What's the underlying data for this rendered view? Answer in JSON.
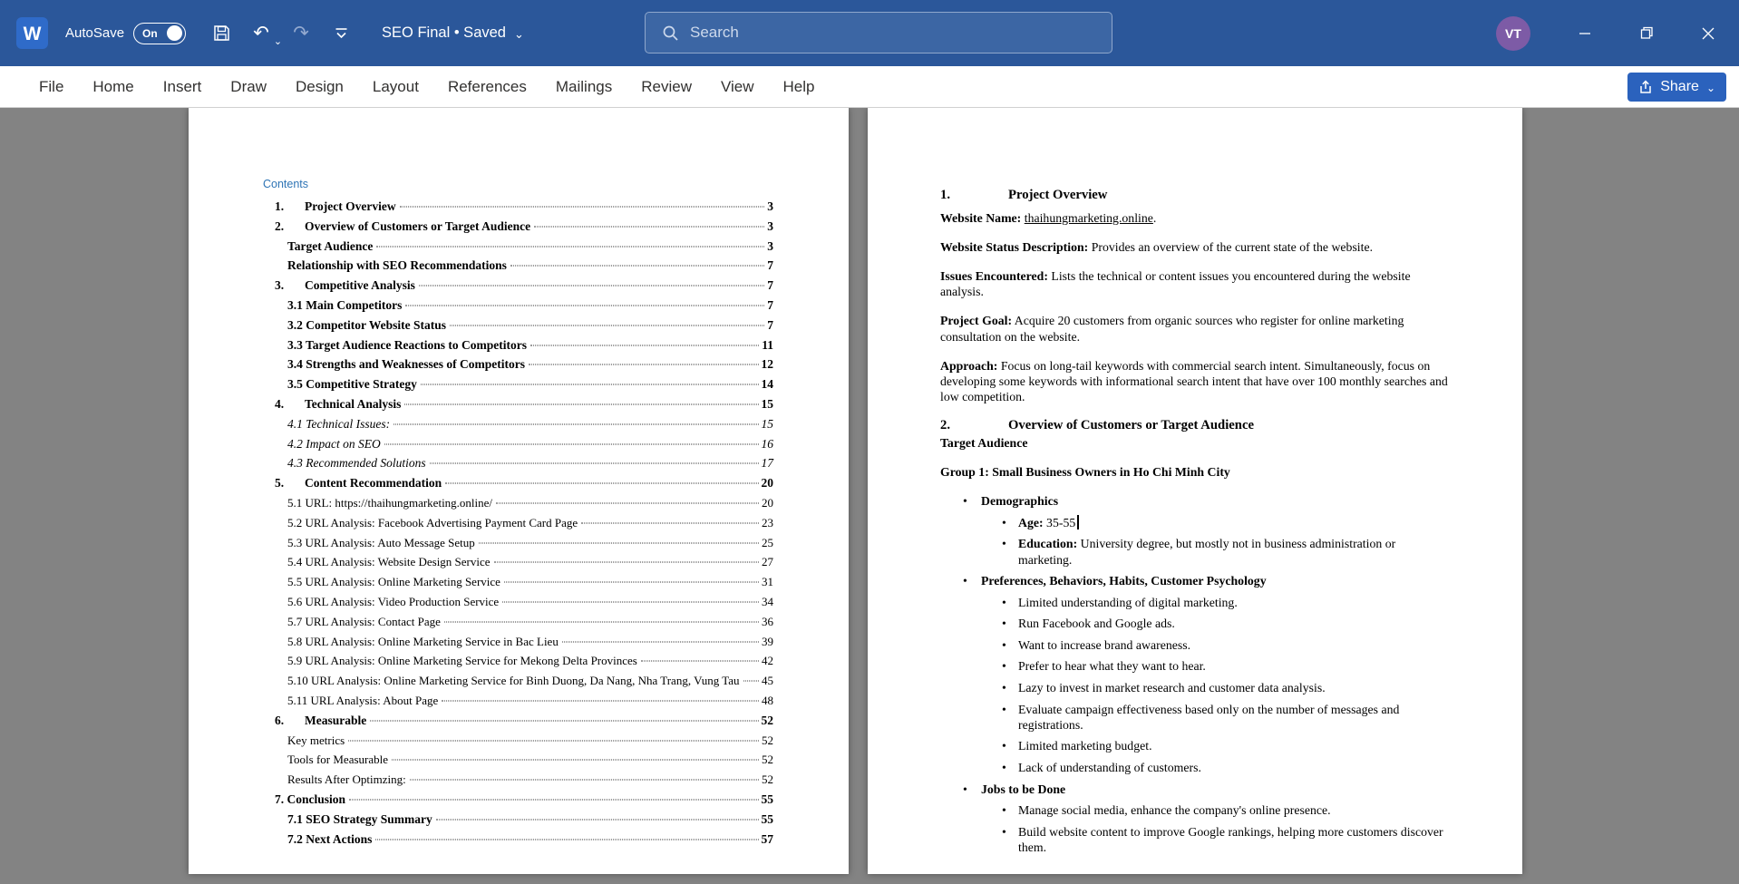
{
  "colors": {
    "titlebar": "#2b579a",
    "search_bg": "#3c66a4",
    "search_border": "#8fa7cc",
    "avatar_bg": "#7d5ba6",
    "toc_heading": "#2e74b5",
    "share_button": "#2b62bd",
    "doc_bg": "#838383"
  },
  "titlebar": {
    "autosave_label": "AutoSave",
    "autosave_state": "On",
    "doc_title": "SEO Final • Saved",
    "search_placeholder": "Search",
    "avatar_initials": "VT"
  },
  "icons": {
    "undo": "↶",
    "redo": "↷",
    "chevron_down": "⌄",
    "bullet": "•"
  },
  "ribbon": {
    "tabs": [
      "File",
      "Home",
      "Insert",
      "Draw",
      "Design",
      "Layout",
      "References",
      "Mailings",
      "Review",
      "View",
      "Help"
    ],
    "share_label": "Share"
  },
  "toc": {
    "heading": "Contents",
    "entries": [
      {
        "num": "1.",
        "label": "Project Overview",
        "page": "3",
        "style": "b",
        "indent": 0
      },
      {
        "num": "2.",
        "label": "Overview of Customers or Target Audience",
        "page": "3",
        "style": "b",
        "indent": 0
      },
      {
        "label": "Target Audience",
        "page": "3",
        "style": "b",
        "indent": 1
      },
      {
        "label": "Relationship with SEO Recommendations",
        "page": "7",
        "style": "b",
        "indent": 1
      },
      {
        "num": "3.",
        "label": "Competitive Analysis",
        "page": "7",
        "style": "b",
        "indent": 0
      },
      {
        "label": "3.1 Main Competitors",
        "page": "7",
        "style": "b",
        "indent": 1
      },
      {
        "label": "3.2 Competitor Website Status",
        "page": "7",
        "style": "b",
        "indent": 1
      },
      {
        "label": "3.3 Target Audience Reactions to Competitors",
        "page": "11",
        "style": "b",
        "indent": 1
      },
      {
        "label": "3.4 Strengths and Weaknesses of Competitors",
        "page": "12",
        "style": "b",
        "indent": 1
      },
      {
        "label": "3.5 Competitive Strategy",
        "page": "14",
        "style": "b",
        "indent": 1
      },
      {
        "num": "4.",
        "label": "Technical Analysis",
        "page": "15",
        "style": "b",
        "indent": 0
      },
      {
        "label": "4.1 Technical Issues:",
        "page": "15",
        "style": "i",
        "indent": 1
      },
      {
        "label": "4.2 Impact on SEO",
        "page": "16",
        "style": "i",
        "indent": 1
      },
      {
        "label": "4.3 Recommended Solutions",
        "page": "17",
        "style": "i",
        "indent": 1
      },
      {
        "num": "5.",
        "label": "Content Recommendation",
        "page": "20",
        "style": "b",
        "indent": 0
      },
      {
        "label": "5.1 URL: https://thaihungmarketing.online/",
        "page": "20",
        "style": "s",
        "indent": 1
      },
      {
        "label": "5.2 URL Analysis: Facebook Advertising Payment Card Page",
        "page": "23",
        "style": "s",
        "indent": 1
      },
      {
        "label": "5.3 URL Analysis: Auto Message Setup",
        "page": "25",
        "style": "s",
        "indent": 1
      },
      {
        "label": "5.4 URL Analysis: Website Design Service",
        "page": "27",
        "style": "s",
        "indent": 1
      },
      {
        "label": "5.5 URL Analysis: Online Marketing Service",
        "page": "31",
        "style": "s",
        "indent": 1
      },
      {
        "label": "5.6 URL Analysis: Video Production Service",
        "page": "34",
        "style": "s",
        "indent": 1
      },
      {
        "label": "5.7 URL Analysis: Contact Page",
        "page": "36",
        "style": "s",
        "indent": 1
      },
      {
        "label": "5.8 URL Analysis: Online Marketing Service in Bac Lieu",
        "page": "39",
        "style": "s",
        "indent": 1
      },
      {
        "label": "5.9 URL Analysis: Online Marketing Service for Mekong Delta Provinces",
        "page": "42",
        "style": "s",
        "indent": 1
      },
      {
        "label": "5.10 URL Analysis: Online Marketing Service for Binh Duong, Da Nang, Nha Trang, Vung Tau",
        "page": "45",
        "style": "s",
        "indent": 1
      },
      {
        "label": "5.11 URL Analysis: About Page",
        "page": "48",
        "style": "s",
        "indent": 1
      },
      {
        "num": "6.",
        "label": "Measurable",
        "page": "52",
        "style": "b",
        "indent": 0
      },
      {
        "label": "Key metrics",
        "page": "52",
        "style": "s",
        "indent": 1
      },
      {
        "label": "Tools for Measurable",
        "page": "52",
        "style": "s",
        "indent": 1
      },
      {
        "label": "Results After Optimzing:",
        "page": "52",
        "style": "s",
        "indent": 1
      },
      {
        "label": "7. Conclusion",
        "page": "55",
        "style": "b",
        "indent": 0
      },
      {
        "label": "7.1 SEO Strategy Summary",
        "page": "55",
        "style": "b",
        "indent": 1
      },
      {
        "label": "7.2 Next Actions",
        "page": "57",
        "style": "b",
        "indent": 1
      }
    ]
  },
  "doc": {
    "section1": {
      "num": "1.",
      "title": "Project Overview"
    },
    "paragraphs": [
      {
        "label": "Website Name:",
        "link": "thaihungmarketing.online",
        "suffix": "."
      },
      {
        "label": "Website Status Description:",
        "text": "Provides an overview of the current state of the website."
      },
      {
        "label": "Issues Encountered:",
        "text": "Lists the technical or content issues you encountered during the website analysis."
      },
      {
        "label": "Project Goal:",
        "text": "Acquire 20 customers from organic sources who register for online marketing consultation on the website."
      },
      {
        "label": "Approach:",
        "text": "Focus on long-tail keywords with commercial search intent. Simultaneously, focus on developing some keywords with informational search intent that have over 100 monthly searches and low competition."
      }
    ],
    "section2": {
      "num": "2.",
      "title": "Overview of Customers or Target Audience"
    },
    "subheading": "Target Audience",
    "group_title": "Group 1: Small Business Owners in Ho Chi Minh City",
    "bullets": [
      {
        "label": "Demographics",
        "children": [
          {
            "label": "Age:",
            "text": "35-55",
            "caret": true
          },
          {
            "label": "Education:",
            "text": "University degree, but mostly not in business administration or marketing."
          }
        ]
      },
      {
        "label": "Preferences, Behaviors, Habits, Customer Psychology",
        "children": [
          {
            "text": "Limited understanding of digital marketing."
          },
          {
            "text": "Run Facebook and Google ads."
          },
          {
            "text": "Want to increase brand awareness."
          },
          {
            "text": "Prefer to hear what they want to hear."
          },
          {
            "text": "Lazy to invest in market research and customer data analysis."
          },
          {
            "text": "Evaluate campaign effectiveness based only on the number of messages and registrations."
          },
          {
            "text": "Limited marketing budget."
          },
          {
            "text": "Lack of understanding of customers."
          }
        ]
      },
      {
        "label": "Jobs to be Done",
        "children": [
          {
            "text": "Manage social media, enhance the company's online presence."
          },
          {
            "text": "Build website content to improve Google rankings, helping more customers discover them."
          }
        ]
      }
    ]
  }
}
